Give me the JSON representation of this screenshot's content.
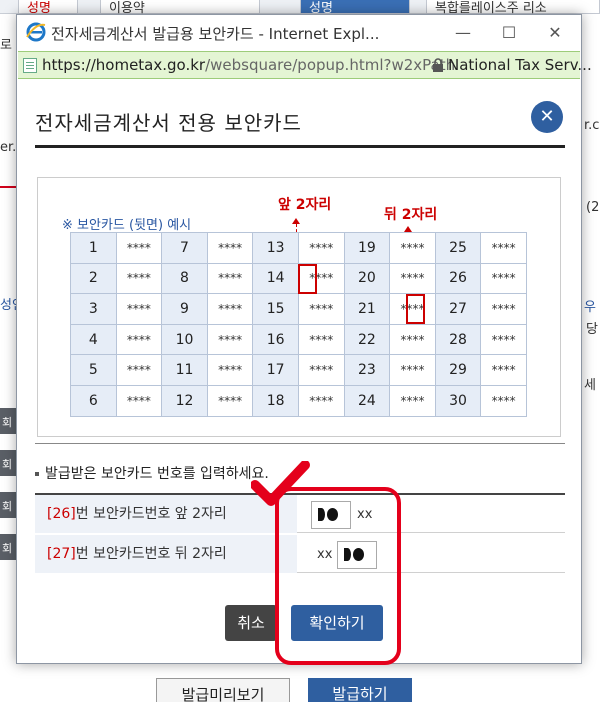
{
  "background": {
    "tabs": [
      "성명",
      "이용약",
      "성명",
      "복합를레이스주 리소"
    ],
    "fragments": [
      "로",
      "er.c",
      "r.co",
      "(2",
      "성인",
      "당",
      "세",
      "우",
      "회",
      "회",
      "회",
      "회"
    ],
    "bottom_buttons": {
      "preview": "발급미리보기",
      "issue": "발급하기"
    }
  },
  "window": {
    "title": "전자세금계산서 발급용 보안카드 - Internet Expl...",
    "url_host": "https://hometax.go.kr",
    "url_path": "/websquare/popup.html?w2xPath",
    "site_id": "National Tax Serv..."
  },
  "dialog": {
    "heading": "전자세금계산서 전용 보안카드",
    "close_symbol": "✕"
  },
  "card": {
    "caption": "※ 보안카드 (뒷면) 예시",
    "front_label": "앞 2자리",
    "back_label": "뒤 2자리",
    "mask": "****",
    "rows": [
      [
        1,
        7,
        13,
        19,
        25
      ],
      [
        2,
        8,
        14,
        20,
        26
      ],
      [
        3,
        9,
        15,
        21,
        27
      ],
      [
        4,
        10,
        16,
        22,
        28
      ],
      [
        5,
        11,
        17,
        23,
        29
      ],
      [
        6,
        12,
        18,
        24,
        30
      ]
    ]
  },
  "form": {
    "instruction": "발급받은 보안카드 번호를 입력하세요.",
    "front": {
      "num": "[26]",
      "label": "번 보안카드번호 앞 2자리",
      "suffix": "xx"
    },
    "back": {
      "num": "[27]",
      "label": "번 보안카드번호 뒤 2자리",
      "prefix": "xx"
    }
  },
  "buttons": {
    "cancel": "취소",
    "confirm": "확인하기"
  },
  "colors": {
    "accent": "#2f5fa0",
    "highlight": "#e4001b",
    "address_bar": "#e4f5d4"
  }
}
